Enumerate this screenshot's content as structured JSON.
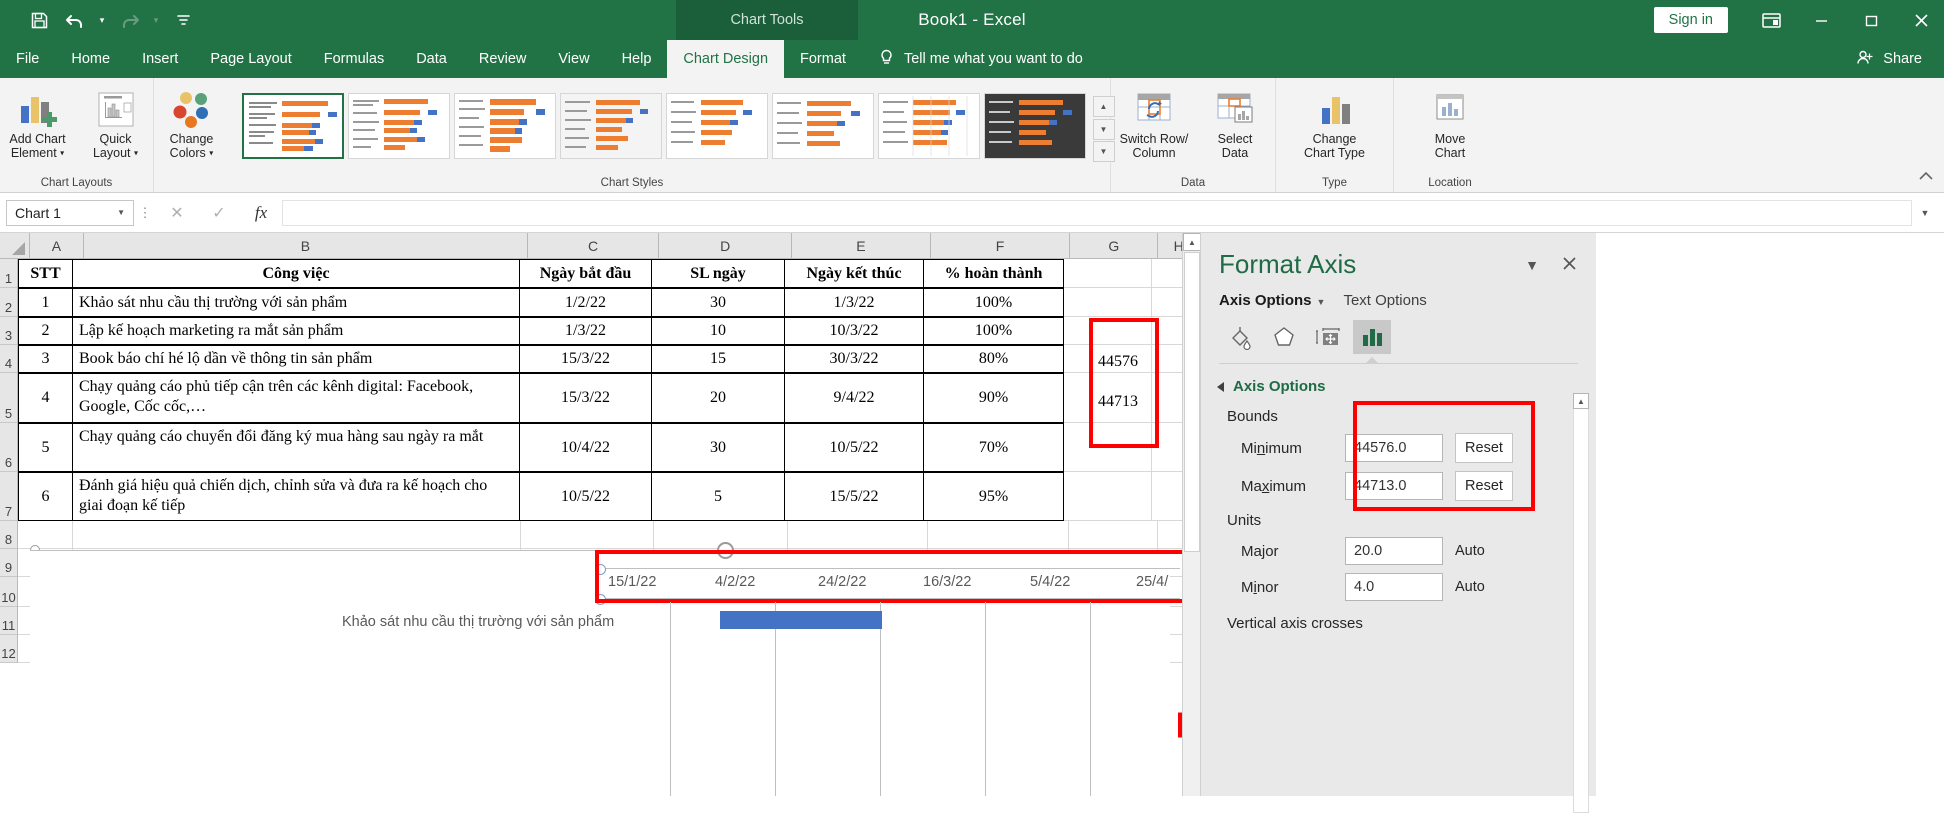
{
  "titlebar": {
    "app_title": "Book1  -  Excel",
    "chart_tools": "Chart Tools",
    "sign_in": "Sign in",
    "qat": [
      {
        "name": "save-icon",
        "label": "Save"
      },
      {
        "name": "undo-icon",
        "label": "Undo"
      },
      {
        "name": "redo-icon",
        "label": "Redo"
      },
      {
        "name": "customize-qat-icon",
        "label": "Customize Quick Access Toolbar"
      }
    ],
    "ribbon_display_options": "Ribbon Display Options",
    "minimize": "Minimize",
    "restore": "Restore Down",
    "close": "Close"
  },
  "tabs": [
    {
      "label": "File",
      "active": false
    },
    {
      "label": "Home",
      "active": false
    },
    {
      "label": "Insert",
      "active": false
    },
    {
      "label": "Page Layout",
      "active": false
    },
    {
      "label": "Formulas",
      "active": false
    },
    {
      "label": "Data",
      "active": false
    },
    {
      "label": "Review",
      "active": false
    },
    {
      "label": "View",
      "active": false
    },
    {
      "label": "Help",
      "active": false
    },
    {
      "label": "Chart Design",
      "active": true
    },
    {
      "label": "Format",
      "active": false
    }
  ],
  "tellme": "Tell me what you want to do",
  "share": "Share",
  "ribbon": {
    "groups": [
      {
        "label": "Chart Layouts"
      },
      {
        "label": "Chart Styles"
      },
      {
        "label": "Data"
      },
      {
        "label": "Type"
      },
      {
        "label": "Location"
      }
    ],
    "add_chart_element": "Add Chart\nElement",
    "add_chart_element_l1": "Add Chart",
    "add_chart_element_l2": "Element",
    "quick_layout_l1": "Quick",
    "quick_layout_l2": "Layout",
    "change_colors_l1": "Change",
    "change_colors_l2": "Colors",
    "switch_row_column_l1": "Switch Row/",
    "switch_row_column_l2": "Column",
    "select_data_l1": "Select",
    "select_data_l2": "Data",
    "change_chart_type_l1": "Change",
    "change_chart_type_l2": "Chart Type",
    "move_chart_l1": "Move",
    "move_chart_l2": "Chart",
    "gallery_up": "Scroll up",
    "gallery_down": "Scroll down",
    "gallery_more": "More chart styles",
    "collapse": "Collapse the Ribbon"
  },
  "formulabar": {
    "namebox_value": "Chart 1",
    "cancel": "Cancel",
    "enter": "Enter",
    "insert_function": "fx",
    "formula_value": "",
    "expand": "Expand Formula Bar"
  },
  "sheet": {
    "column_headers": [
      "A",
      "B",
      "C",
      "D",
      "E",
      "F",
      "G",
      "H"
    ],
    "row_headers": [
      "1",
      "2",
      "3",
      "4",
      "5",
      "6",
      "7",
      "8",
      "9",
      "10",
      "11",
      "12"
    ],
    "table_headers": [
      "STT",
      "Công việc",
      "Ngày bắt đầu",
      "SL ngày",
      "Ngày kết thúc",
      "% hoàn thành"
    ],
    "rows": [
      {
        "stt": "1",
        "task": "Khảo sát nhu cầu thị trường với sản phẩm",
        "start": "1/2/22",
        "days": "30",
        "end": "1/3/22",
        "percent": "100%"
      },
      {
        "stt": "2",
        "task": "Lập kế hoạch marketing ra mắt sản phẩm",
        "start": "1/3/22",
        "days": "10",
        "end": "10/3/22",
        "percent": "100%"
      },
      {
        "stt": "3",
        "task": "Book báo chí hé lộ dần về thông tin sản phẩm",
        "start": "15/3/22",
        "days": "15",
        "end": "30/3/22",
        "percent": "80%"
      },
      {
        "stt": "4",
        "task": "Chạy quảng cáo phủ tiếp cận trên các kênh digital: Facebook, Google, Cốc cốc,…",
        "start": "15/3/22",
        "days": "20",
        "end": "9/4/22",
        "percent": "90%"
      },
      {
        "stt": "5",
        "task": "Chạy quảng cáo chuyển đổi đăng ký mua hàng sau ngày ra mắt",
        "start": "10/4/22",
        "days": "30",
        "end": "10/5/22",
        "percent": "70%"
      },
      {
        "stt": "6",
        "task": "Đánh giá hiệu quả chiến dịch, chỉnh sửa và đưa ra kế hoạch cho giai đoạn kế tiếp",
        "start": "10/5/22",
        "days": "5",
        "end": "15/5/22",
        "percent": "95%"
      }
    ],
    "serial_values": [
      "44576",
      "44713"
    ]
  },
  "chart_data": {
    "type": "bar",
    "title": "",
    "orientation": "horizontal",
    "categories": [
      "Khảo sát nhu cầu thị trường với sản phẩm"
    ],
    "series": [
      {
        "name": "Ngày bắt đầu",
        "values": [
          44593
        ]
      },
      {
        "name": "SL ngày",
        "values": [
          30
        ]
      }
    ],
    "x_axis_tick_labels": [
      "15/1/22",
      "4/2/22",
      "24/2/22",
      "16/3/22",
      "5/4/22",
      "25/4/"
    ],
    "xlim": [
      44576,
      44713
    ],
    "major_unit": 20,
    "minor_unit": 4,
    "grid": true,
    "bar_color": "#4472c4",
    "visible_category_label": "Khảo sát nhu cầu thị trường với sản phẩm"
  },
  "pane": {
    "title": "Format Axis",
    "dropdown": "Pane options",
    "close": "Close",
    "tab_axis_options": "Axis Options",
    "tab_text_options": "Text Options",
    "icons": [
      {
        "name": "fill-line-icon",
        "active": false
      },
      {
        "name": "effects-icon",
        "active": false
      },
      {
        "name": "size-properties-icon",
        "active": false
      },
      {
        "name": "axis-options-icon",
        "active": true
      }
    ],
    "section_axis_options": "Axis Options",
    "bounds_label": "Bounds",
    "minimum_label": "Minimum",
    "minimum_value": "44576.0",
    "minimum_reset": "Reset",
    "maximum_label": "Maximum",
    "maximum_value": "44713.0",
    "maximum_reset": "Reset",
    "units_label": "Units",
    "major_label": "Major",
    "major_value": "20.0",
    "major_auto": "Auto",
    "minor_label": "Minor",
    "minor_value": "4.0",
    "minor_auto": "Auto",
    "vertical_axis_crosses": "Vertical axis crosses"
  },
  "colors": {
    "excel_green": "#217346",
    "chart_tools_band": "#1b5e3a",
    "accent_green": "#1e6b45",
    "highlight_red": "#ff0000",
    "bar_blue": "#4472c4"
  }
}
